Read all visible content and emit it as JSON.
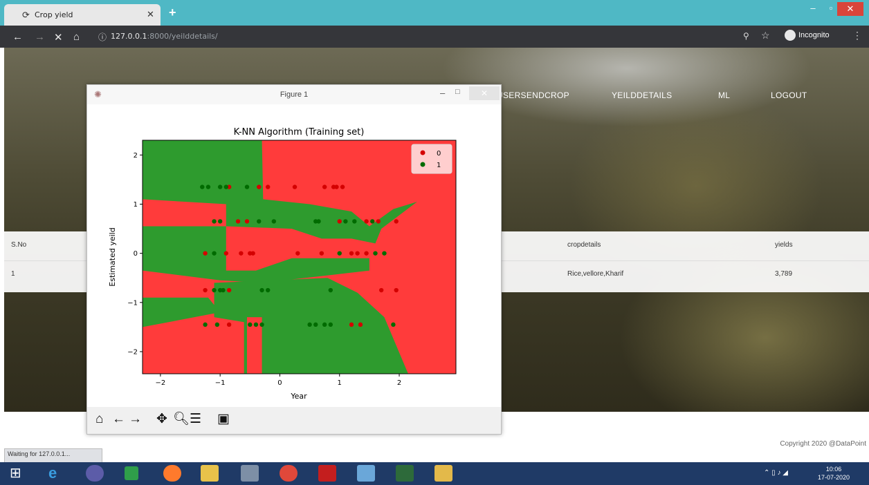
{
  "browser": {
    "tab_title": "Crop yield",
    "tab_close": "✕",
    "new_tab": "+",
    "min": "–",
    "max": "▫",
    "close": "✕",
    "back_icon": "←",
    "forward_icon": "→",
    "reload_icon": "✕",
    "home_icon": "⌂",
    "url_host": "127.0.0.1",
    "url_rest": ":8000/yeilddetails/",
    "zoom_icon": "⚲",
    "star_icon": "☆",
    "incognito": "Incognito",
    "menu_icon": "⋮"
  },
  "site": {
    "menu": [
      "USERSENDCROP",
      "YEILDDETAILS",
      "ML",
      "LOGOUT"
    ],
    "table": {
      "headers": [
        "S.No",
        "cropdetails",
        "yields"
      ],
      "rows": [
        [
          "1",
          "Rice,vellore,Kharif",
          "3,789"
        ]
      ]
    },
    "copyright": "Copyright 2020 @DataPoint"
  },
  "status_text": "Waiting for 127.0.0.1...",
  "figure": {
    "window_title": "Figure 1",
    "min": "–",
    "max": "□",
    "close": "✕"
  },
  "chart_data": {
    "type": "scatter",
    "title": "K-NN Algorithm (Training set)",
    "xlabel": "Year",
    "ylabel": "Estimated yeild",
    "xlim": [
      -2.3,
      2.95
    ],
    "ylim": [
      -2.45,
      2.3
    ],
    "xticks": [
      -2,
      -1,
      0,
      1,
      2
    ],
    "yticks": [
      -2,
      -1,
      0,
      1,
      2
    ],
    "legend_position": "top-right",
    "region_colors": {
      "0": "#ff3b3b",
      "1": "#2e9b2e"
    },
    "series": [
      {
        "name": "0",
        "color": "#d40000",
        "points": [
          [
            -0.85,
            1.35
          ],
          [
            -0.35,
            1.35
          ],
          [
            -0.2,
            1.35
          ],
          [
            0.25,
            1.35
          ],
          [
            0.75,
            1.35
          ],
          [
            0.9,
            1.35
          ],
          [
            0.95,
            1.35
          ],
          [
            1.05,
            1.35
          ],
          [
            -0.7,
            0.65
          ],
          [
            -0.55,
            0.65
          ],
          [
            1.0,
            0.65
          ],
          [
            1.45,
            0.65
          ],
          [
            1.65,
            0.65
          ],
          [
            1.95,
            0.65
          ],
          [
            -1.25,
            0
          ],
          [
            -0.9,
            0
          ],
          [
            -0.65,
            0
          ],
          [
            -0.5,
            0
          ],
          [
            -0.45,
            0
          ],
          [
            0.3,
            0
          ],
          [
            0.7,
            0
          ],
          [
            1.2,
            0
          ],
          [
            1.3,
            0
          ],
          [
            1.45,
            0
          ],
          [
            -1.25,
            -0.75
          ],
          [
            -0.85,
            -0.75
          ],
          [
            1.7,
            -0.75
          ],
          [
            1.95,
            -0.75
          ],
          [
            -0.85,
            -1.45
          ],
          [
            1.2,
            -1.45
          ],
          [
            1.35,
            -1.45
          ]
        ]
      },
      {
        "name": "1",
        "color": "#006b00",
        "points": [
          [
            -1.3,
            1.35
          ],
          [
            -1.2,
            1.35
          ],
          [
            -1.0,
            1.35
          ],
          [
            -0.9,
            1.35
          ],
          [
            -0.55,
            1.35
          ],
          [
            -1.1,
            0.65
          ],
          [
            -1.0,
            0.65
          ],
          [
            -0.35,
            0.65
          ],
          [
            -0.1,
            0.65
          ],
          [
            0.6,
            0.65
          ],
          [
            0.65,
            0.65
          ],
          [
            1.1,
            0.65
          ],
          [
            1.25,
            0.65
          ],
          [
            1.55,
            0.65
          ],
          [
            -1.1,
            0
          ],
          [
            1.0,
            0
          ],
          [
            1.6,
            0
          ],
          [
            1.75,
            0
          ],
          [
            -1.1,
            -0.75
          ],
          [
            -1.0,
            -0.75
          ],
          [
            -0.95,
            -0.75
          ],
          [
            -0.3,
            -0.75
          ],
          [
            -0.2,
            -0.75
          ],
          [
            0.85,
            -0.75
          ],
          [
            -1.25,
            -1.45
          ],
          [
            -1.05,
            -1.45
          ],
          [
            -0.5,
            -1.45
          ],
          [
            -0.4,
            -1.45
          ],
          [
            -0.3,
            -1.45
          ],
          [
            0.5,
            -1.45
          ],
          [
            0.6,
            -1.45
          ],
          [
            0.75,
            -1.45
          ],
          [
            0.85,
            -1.45
          ],
          [
            1.9,
            -1.45
          ]
        ]
      }
    ]
  },
  "toolbar_icons": [
    "home-icon",
    "back-icon",
    "forward-icon",
    "pan-icon",
    "zoom-icon",
    "configure-icon",
    "save-icon"
  ],
  "taskbar": {
    "time": "10:06",
    "date": "17-07-2020"
  }
}
